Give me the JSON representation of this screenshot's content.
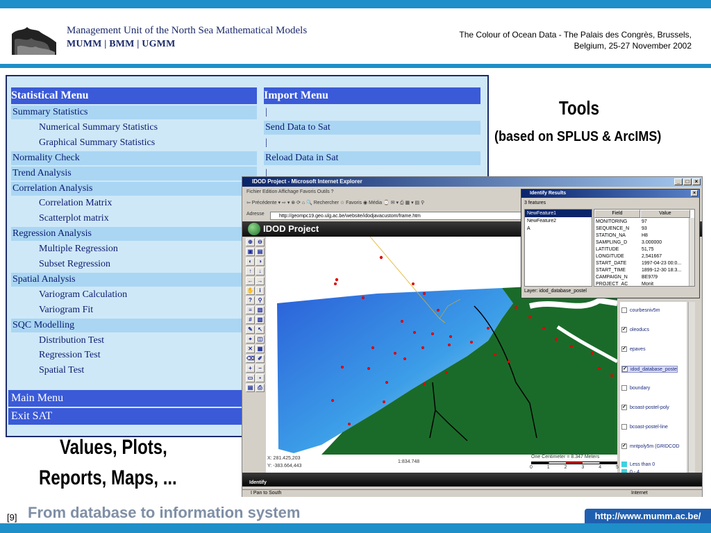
{
  "header": {
    "org_line1": "Management Unit of the North Sea Mathematical Models",
    "org_line2": "MUMM | BMM | UGMM",
    "conference_line1": "The Colour of Ocean Data - The Palais des Congrès, Brussels,",
    "conference_line2": "Belgium, 25-27 November 2002"
  },
  "menu": {
    "statistical_title": "Statistical Menu",
    "import_title": "Import Menu",
    "items": [
      {
        "label": "Summary Statistics",
        "level": 0
      },
      {
        "label": "Numerical Summary Statistics",
        "level": 1
      },
      {
        "label": "Graphical Summary Statistics",
        "level": 1
      },
      {
        "label": "Normality Check",
        "level": 0
      },
      {
        "label": "Trend Analysis",
        "level": 0
      },
      {
        "label": "Correlation Analysis",
        "level": 0
      },
      {
        "label": "Correlation Matrix",
        "level": 1
      },
      {
        "label": "Scatterplot matrix",
        "level": 1
      },
      {
        "label": "Regression Analysis",
        "level": 0
      },
      {
        "label": "Multiple Regression",
        "level": 1
      },
      {
        "label": "Subset Regression",
        "level": 1
      },
      {
        "label": "Spatial Analysis",
        "level": 0
      },
      {
        "label": "Variogram Calculation",
        "level": 1
      },
      {
        "label": "Variogram Fit",
        "level": 1
      },
      {
        "label": "SQC Modelling",
        "level": 0
      },
      {
        "label": "Distribution Test",
        "level": 1
      },
      {
        "label": "Regression Test",
        "level": 1
      },
      {
        "label": "Spatial Test",
        "level": 1
      }
    ],
    "import_items": [
      "|",
      "Send Data to Sat",
      "|",
      "Reload Data in Sat",
      "|"
    ],
    "main_menu": "Main Menu",
    "exit": "Exit SAT"
  },
  "titles": {
    "tools": "Tools",
    "tools_sub": "(based on SPLUS & ArcIMS)",
    "values_line1": "Values, Plots,",
    "values_line2": "Reports, Maps, ..."
  },
  "footer": {
    "page": "[9]",
    "title": "From database to information system",
    "url": "http://www.mumm.ac.be/"
  },
  "browser": {
    "title": "IDOD Project - Microsoft Internet Explorer",
    "menu": "Fichier   Edition   Affichage   Favoris   Outils   ?",
    "toolbar": "⇦ Précédente  ▾  ⇨  ▾   ⊗   ⟳   ⌂    🔍 Rechercher   ☆ Favoris   ◉ Média   ⌚   ✉ ▾   ⎙   ▦ ▾   ▤   ⚲",
    "address_label": "Adresse",
    "address": "http://geompc19.geo.ulg.ac.be/website/idodjavacustom/frame.htm",
    "app_title": "IDOD Project",
    "coord_x": "X: 281.425,203",
    "coord_y": "Y: -383.664,443",
    "scale_ratio": "1:834.748",
    "scale_text": "One Centimeter = 8.347 Meters",
    "scale_ticks": [
      "0",
      "1",
      "2",
      "3",
      "4",
      "5"
    ],
    "mode": "Identify",
    "status_left": "I Pan to South",
    "status_right": "Internet"
  },
  "layers": [
    {
      "name": "courbesniv5m",
      "checked": false
    },
    {
      "name": "oleoducs",
      "checked": true
    },
    {
      "name": "epaves",
      "checked": true
    },
    {
      "name": "idod_database_poste",
      "checked": true,
      "selected": true
    },
    {
      "name": "boundary",
      "checked": false
    },
    {
      "name": "bcoast-postel-poly",
      "checked": true
    },
    {
      "name": "bcoast-postel-line",
      "checked": false
    },
    {
      "name": "mntpoly5m (GRIDCOD",
      "checked": true
    },
    {
      "name": "Less than 0",
      "checked": false
    },
    {
      "name": "0 - 4",
      "checked": false
    }
  ],
  "identify": {
    "title": "Identify Results",
    "count": "3 features",
    "features": [
      "NewFeature1",
      "NewFeature2",
      "A"
    ],
    "col_field": "Field",
    "col_value": "Value",
    "rows": [
      {
        "field": "MONITORING",
        "value": "97"
      },
      {
        "field": "SEQUENCE_N",
        "value": "93"
      },
      {
        "field": "STATION_NA",
        "value": "H8"
      },
      {
        "field": "SAMPLING_D",
        "value": "3.000000"
      },
      {
        "field": "LATITUDE",
        "value": "51,75"
      },
      {
        "field": "LONGITUDE",
        "value": "2,541667"
      },
      {
        "field": "START_DATE",
        "value": "1997-04-23 00:0..."
      },
      {
        "field": "START_TIME",
        "value": "1899-12-30 18:3..."
      },
      {
        "field": "CAMPAIGN_N",
        "value": "BE97/9"
      },
      {
        "field": "PROJECT_AC",
        "value": "Monit"
      }
    ],
    "layer_label": "Layer: idod_database_postel"
  },
  "colors": {
    "accent": "#1e8fc8",
    "menu_header": "#3a5ad8",
    "sea": "#2b5fd8",
    "land": "#1a6b2a",
    "station": "#e00000"
  }
}
